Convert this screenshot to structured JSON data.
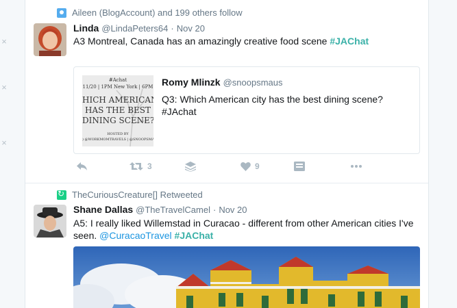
{
  "tweets": [
    {
      "context": "Aileen (BlogAccount) and 199 others follow",
      "fullname": "Linda",
      "handle": "@LindaPeters64",
      "separator": "·",
      "time": "Nov 20",
      "text": "A3 Montreal, Canada has an amazingly creative food scene ",
      "hashtag": "#JAChat",
      "quote": {
        "fullname": "Romy Mlinzk",
        "handle": "@snoopsmaus",
        "text": "Q3: Which American city has the best dining scene? #JAchat",
        "media_lines": [
          "#Achat",
          "11/20 | 1PM New York | 6PM",
          "HICH AMERICAN",
          "HAS THE BEST",
          "DINING SCENE?",
          "HOSTED BY",
          ") @WORKMOMTRAVELS | @SNOOPSMAU"
        ]
      },
      "actions": {
        "retweets": "3",
        "likes": "9"
      }
    },
    {
      "context": "TheCuriousCreature[] Retweeted",
      "fullname": "Shane Dallas",
      "handle": "@TheTravelCamel",
      "separator": "·",
      "time": "Nov 20",
      "text": "A5: I really liked Willemstad in Curacao - different from other American cities I've seen. ",
      "mention": "@CuracaoTravel",
      "hashtag": "#JAChat"
    }
  ],
  "dismiss_glyph": "×",
  "colors": {
    "hashtag": "#3bb1a8",
    "link": "#1b95e0",
    "muted": "#657786",
    "action": "#aab8c2"
  }
}
